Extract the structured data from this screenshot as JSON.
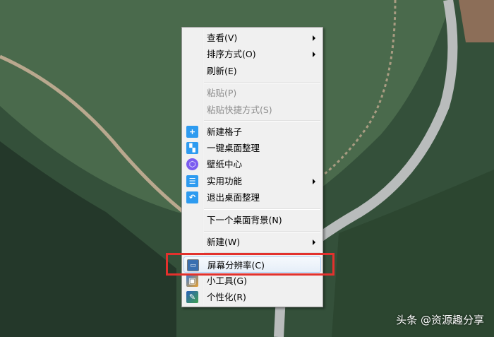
{
  "menu": {
    "items": [
      {
        "label": "查看(V)",
        "submenu": true
      },
      {
        "label": "排序方式(O)",
        "submenu": true
      },
      {
        "label": "刷新(E)"
      },
      {
        "label": "粘贴(P)",
        "disabled": true
      },
      {
        "label": "粘贴快捷方式(S)",
        "disabled": true
      },
      {
        "label": "新建格子",
        "icon": "plus-icon"
      },
      {
        "label": "一键桌面整理",
        "icon": "layout-icon"
      },
      {
        "label": "壁纸中心",
        "icon": "cube-icon"
      },
      {
        "label": "实用功能",
        "icon": "list-icon",
        "submenu": true
      },
      {
        "label": "退出桌面整理",
        "icon": "undo-icon"
      },
      {
        "label": "下一个桌面背景(N)"
      },
      {
        "label": "新建(W)",
        "submenu": true
      },
      {
        "label": "屏幕分辨率(C)",
        "icon": "monitor-icon",
        "highlighted": true
      },
      {
        "label": "小工具(G)",
        "icon": "gadgets-icon"
      },
      {
        "label": "个性化(R)",
        "icon": "personalize-icon"
      }
    ]
  },
  "watermark": "头条 @资源趣分享",
  "colors": {
    "icon_blue": "#2d9bf0",
    "icon_purple": "#7b5cf0",
    "highlight_box": "#e2312d"
  }
}
